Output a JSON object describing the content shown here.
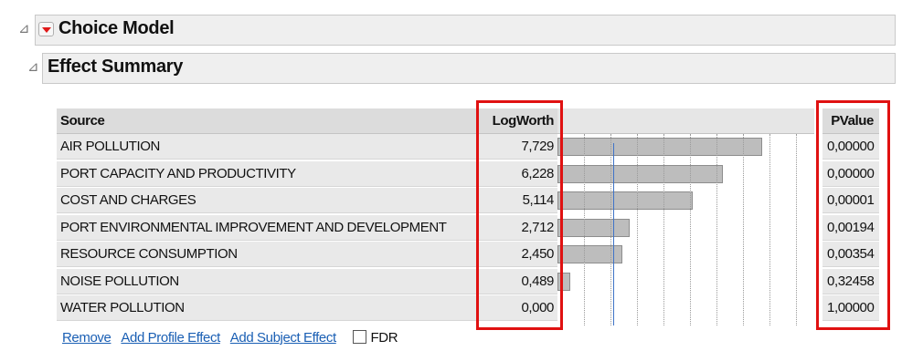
{
  "outline": {
    "choice_model": {
      "title": "Choice Model"
    },
    "effect_summary": {
      "title": "Effect Summary"
    }
  },
  "table": {
    "headers": {
      "source": "Source",
      "logworth": "LogWorth",
      "pvalue": "PValue"
    },
    "rows": [
      {
        "source": "AIR POLLUTION",
        "logworth": "7,729",
        "pvalue": "0,00000"
      },
      {
        "source": "PORT CAPACITY AND PRODUCTIVITY",
        "logworth": "6,228",
        "pvalue": "0,00000"
      },
      {
        "source": "COST AND CHARGES",
        "logworth": "5,114",
        "pvalue": "0,00001"
      },
      {
        "source": "PORT ENVIRONMENTAL IMPROVEMENT AND DEVELOPMENT",
        "logworth": "2,712",
        "pvalue": "0,00194"
      },
      {
        "source": "RESOURCE CONSUMPTION",
        "logworth": "2,450",
        "pvalue": "0,00354"
      },
      {
        "source": "NOISE POLLUTION",
        "logworth": "0,489",
        "pvalue": "0,32458"
      },
      {
        "source": "WATER POLLUTION",
        "logworth": "0,000",
        "pvalue": "1,00000"
      }
    ]
  },
  "chart_data": {
    "type": "bar",
    "orientation": "horizontal",
    "categories": [
      "AIR POLLUTION",
      "PORT CAPACITY AND PRODUCTIVITY",
      "COST AND CHARGES",
      "PORT ENVIRONMENTAL IMPROVEMENT AND DEVELOPMENT",
      "RESOURCE CONSUMPTION",
      "NOISE POLLUTION",
      "WATER POLLUTION"
    ],
    "values": [
      7.729,
      6.228,
      5.114,
      2.712,
      2.45,
      0.489,
      0.0
    ],
    "xlim": [
      0,
      10
    ],
    "reference_line": 2,
    "grid": true
  },
  "footer": {
    "remove": "Remove",
    "add_profile_effect": "Add Profile Effect",
    "add_subject_effect": "Add Subject Effect",
    "fdr": "FDR"
  },
  "colors": {
    "highlight_box": "#e01111",
    "bar_fill": "#bdbdbd",
    "reference_line": "#3f73c7",
    "link": "#1a5fb4"
  }
}
